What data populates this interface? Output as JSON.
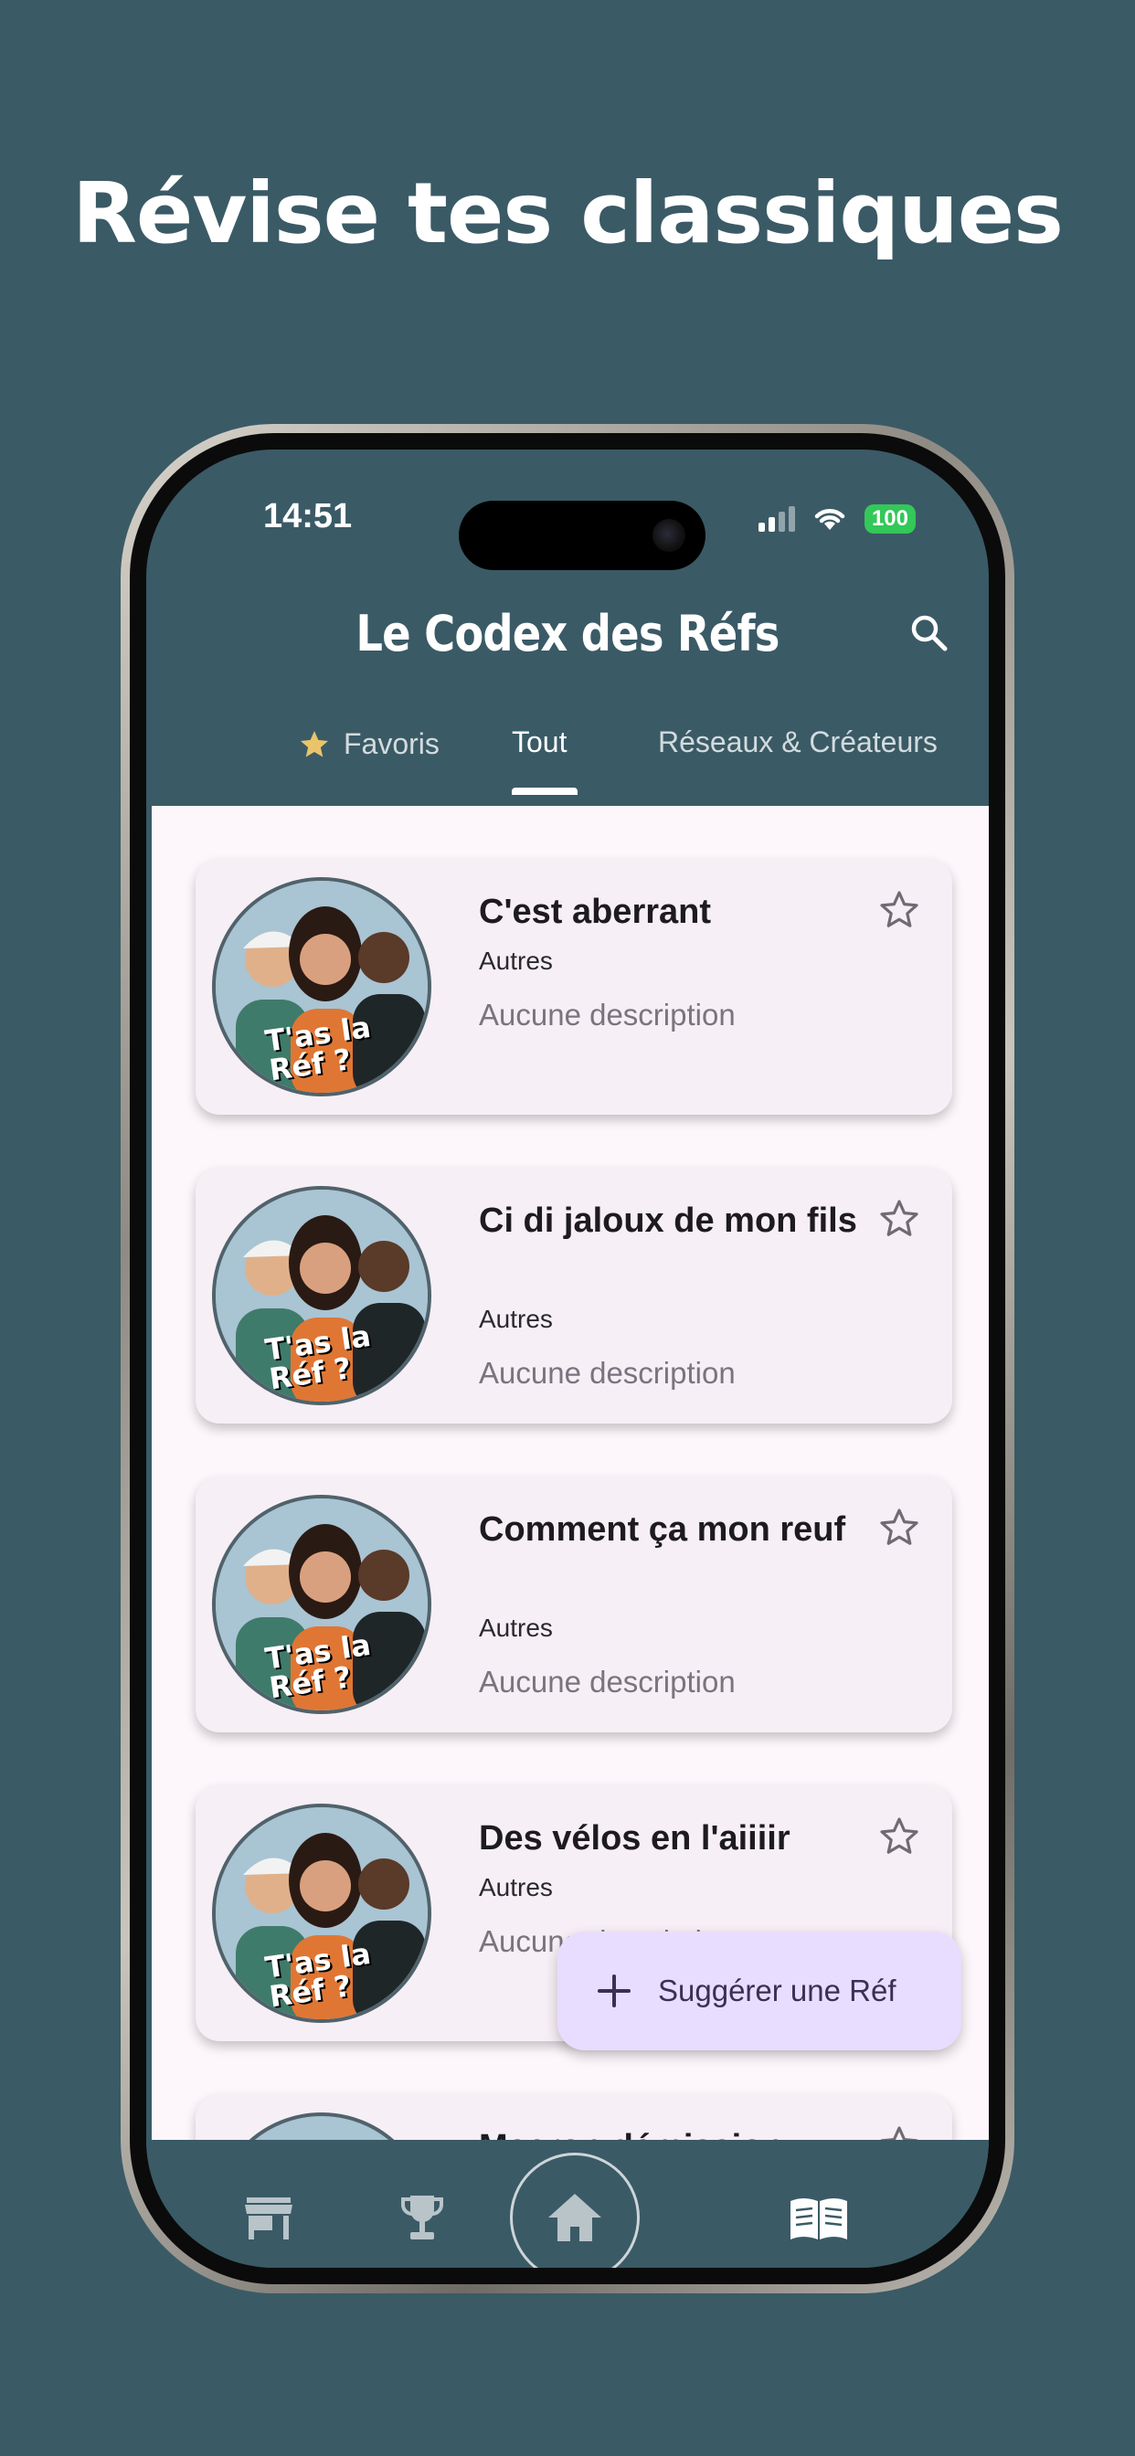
{
  "headline": "Révise tes classiques",
  "status_bar": {
    "time": "14:51",
    "battery": "100"
  },
  "app_bar": {
    "title": "Le Codex des Réfs",
    "search_icon": "search-icon"
  },
  "tabs": [
    {
      "label": "Favoris",
      "icon": "star-icon",
      "active": false
    },
    {
      "label": "Tout",
      "active": true
    },
    {
      "label": "Réseaux & Créateurs",
      "active": false
    }
  ],
  "cards": [
    {
      "title": "C'est aberrant",
      "category": "Autres",
      "description": "Aucune description",
      "badge": "T'as la Réf ?"
    },
    {
      "title": "Ci di jaloux de mon fils",
      "category": "Autres",
      "description": "Aucune description",
      "badge": "T'as la Réf ?"
    },
    {
      "title": "Comment ça mon reuf",
      "category": "Autres",
      "description": "Aucune description",
      "badge": "T'as la Réf ?"
    },
    {
      "title": "Des vélos en l'aiiiir",
      "category": "Autres",
      "description": "Aucune description",
      "badge": "T'as la Réf ?"
    },
    {
      "title": "Macron démission",
      "category": "",
      "description": "",
      "badge": ""
    }
  ],
  "fab": {
    "label": "Suggérer une Réf",
    "icon": "plus-icon"
  },
  "bottom_nav": [
    {
      "name": "store-icon"
    },
    {
      "name": "trophy-icon"
    },
    {
      "name": "home-icon",
      "active": true
    },
    {
      "name": "book-icon"
    }
  ],
  "colors": {
    "background": "#3a5a66",
    "content_bg": "#fdf7fb",
    "card_bg": "#f6eff5",
    "fab_bg": "#e8ddff",
    "star_yellow": "#e9c46a"
  }
}
